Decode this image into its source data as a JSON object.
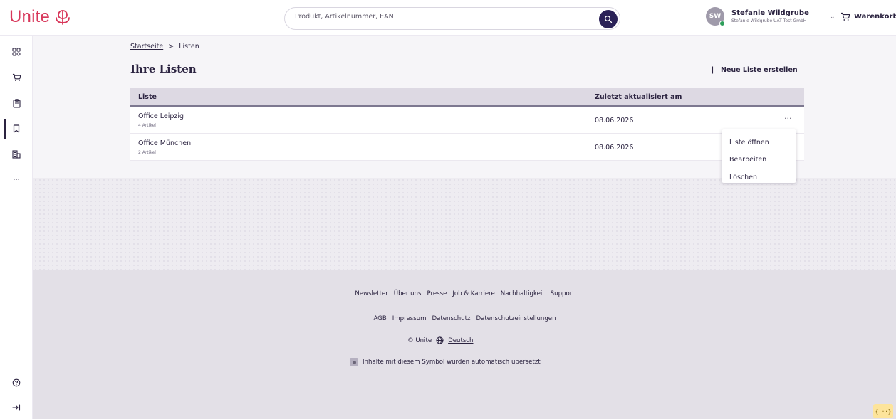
{
  "brand": {
    "name": "Unite",
    "color": "#d8375a"
  },
  "search": {
    "placeholder": "Produkt, Artikelnummer, EAN",
    "value": ""
  },
  "user": {
    "initials": "SW",
    "name": "Stefanie Wildgrube",
    "company": "Stefanie Wildgrube UAT Test GmbH",
    "status_color": "#2e9e5b"
  },
  "cart": {
    "label": "Warenkorb"
  },
  "sidebar": {
    "items": [
      {
        "icon": "grid-icon"
      },
      {
        "icon": "cart-icon"
      },
      {
        "icon": "clipboard-icon"
      },
      {
        "icon": "bookmark-icon",
        "active": true
      },
      {
        "icon": "building-icon"
      },
      {
        "icon": "more-icon",
        "label": "···"
      }
    ],
    "bottom": [
      {
        "icon": "help-icon"
      },
      {
        "icon": "expand-icon"
      }
    ]
  },
  "breadcrumb": {
    "home": "Startseite",
    "separator": ">",
    "current": "Listen"
  },
  "page": {
    "title": "Ihre Listen",
    "new_list_label": "Neue Liste erstellen"
  },
  "table": {
    "headers": {
      "name": "Liste",
      "date": "Zuletzt aktualisiert am"
    },
    "rows": [
      {
        "name": "Office Leipzig",
        "count": "4 Artikel",
        "date": "08.06.2026",
        "more": "···"
      },
      {
        "name": "Office München",
        "count": "2 Artikel",
        "date": "08.06.2026"
      }
    ]
  },
  "context_menu": {
    "items": [
      "Liste öffnen",
      "Bearbeiten",
      "Löschen"
    ]
  },
  "footer": {
    "links_row1": [
      "Newsletter",
      "Über uns",
      "Presse",
      "Job & Karriere",
      "Nachhaltigkeit",
      "Support"
    ],
    "links_row2": [
      "AGB",
      "Impressum",
      "Datenschutz",
      "Datenschutzeinstellungen"
    ],
    "copyright": "© Unite",
    "language": "Deutsch",
    "translation_note": "Inhalte mit diesem Symbol wurden automatisch übersetzt"
  },
  "dev_badge": "{···}"
}
